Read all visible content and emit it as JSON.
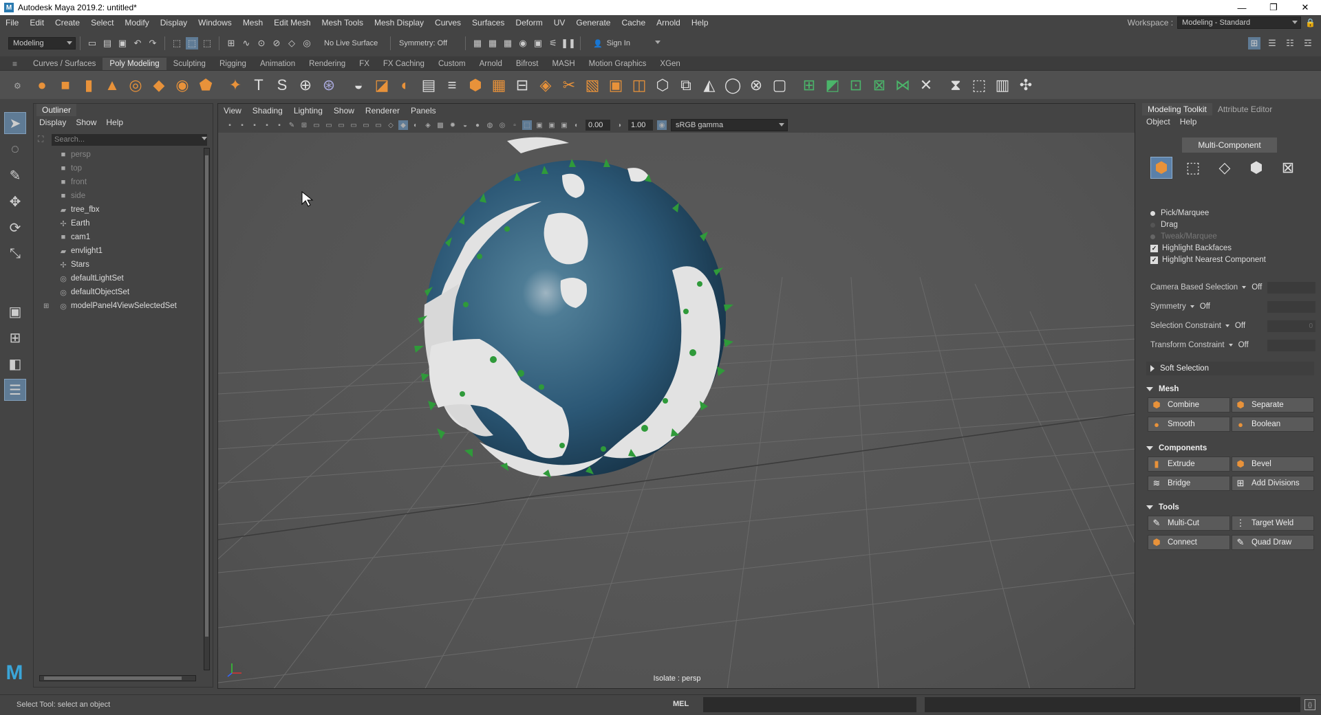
{
  "title": "Autodesk Maya 2019.2: untitled*",
  "window_controls": {
    "minimize": "—",
    "restore": "❐",
    "close": "✕"
  },
  "menu": [
    "File",
    "Edit",
    "Create",
    "Select",
    "Modify",
    "Display",
    "Windows",
    "Mesh",
    "Edit Mesh",
    "Mesh Tools",
    "Mesh Display",
    "Curves",
    "Surfaces",
    "Deform",
    "UV",
    "Generate",
    "Cache",
    "Arnold",
    "Help"
  ],
  "workspace": {
    "label": "Workspace :",
    "value": "Modeling - Standard"
  },
  "statusline": {
    "mode": "Modeling",
    "live_surface": "No Live Surface",
    "symmetry": "Symmetry: Off",
    "sign_in": "Sign In"
  },
  "shelf_tabs": [
    "Curves / Surfaces",
    "Poly Modeling",
    "Sculpting",
    "Rigging",
    "Animation",
    "Rendering",
    "FX",
    "FX Caching",
    "Custom",
    "Arnold",
    "Bifrost",
    "MASH",
    "Motion Graphics",
    "XGen"
  ],
  "shelf_active": "Poly Modeling",
  "shelf_icons": [
    "sphere",
    "cube",
    "cylinder",
    "cone",
    "torus",
    "plane",
    "disc",
    "platonic",
    "superShape",
    "type",
    "svg",
    "pivot",
    "uv",
    "combine",
    "separate",
    "bool",
    "extrude",
    "bridge",
    "bevel",
    "edge",
    "insert",
    "target",
    "multicut",
    "offset",
    "fill",
    "append",
    "smooth",
    "mirror",
    "reduce",
    "circularize",
    "pin",
    "uv-editor",
    "uv-planar",
    "uv-auto",
    "uv-cyl",
    "uv-sph",
    "uv-snap",
    "uv-cut",
    "uv-sew",
    "uv-unfold",
    "uv-layout",
    "uv-distort"
  ],
  "outliner": {
    "tab": "Outliner",
    "menu": [
      "Display",
      "Show",
      "Help"
    ],
    "search_placeholder": "Search...",
    "items": [
      {
        "label": "persp",
        "icon": "camera-icon",
        "dim": true
      },
      {
        "label": "top",
        "icon": "camera-icon",
        "dim": true
      },
      {
        "label": "front",
        "icon": "camera-icon",
        "dim": true
      },
      {
        "label": "side",
        "icon": "camera-icon",
        "dim": true
      },
      {
        "label": "tree_fbx",
        "icon": "mesh-icon",
        "dim": false
      },
      {
        "label": "Earth",
        "icon": "transform-icon",
        "dim": false
      },
      {
        "label": "cam1",
        "icon": "camera-icon",
        "dim": false
      },
      {
        "label": "envlight1",
        "icon": "mesh-icon",
        "dim": false
      },
      {
        "label": "Stars",
        "icon": "transform-icon",
        "dim": false
      },
      {
        "label": "defaultLightSet",
        "icon": "set-icon",
        "dim": false
      },
      {
        "label": "defaultObjectSet",
        "icon": "set-icon",
        "dim": false
      },
      {
        "label": "modelPanel4ViewSelectedSet",
        "icon": "set-icon",
        "dim": false,
        "expand": "⊞"
      }
    ]
  },
  "viewport": {
    "menu": [
      "View",
      "Shading",
      "Lighting",
      "Show",
      "Renderer",
      "Panels"
    ],
    "exposure": "0.00",
    "gamma": "1.00",
    "color_space": "sRGB gamma",
    "isolate_label": "Isolate : persp"
  },
  "modeling_toolkit": {
    "tabs": [
      "Modeling Toolkit",
      "Attribute Editor"
    ],
    "menu": [
      "Object",
      "Help"
    ],
    "multi_component": "Multi-Component",
    "selection_modes": [
      {
        "label": "Pick/Marquee",
        "dim": false
      },
      {
        "label": "Drag",
        "dim": false
      },
      {
        "label": "Tweak/Marquee",
        "dim": true
      }
    ],
    "checkboxes": [
      {
        "label": "Highlight Backfaces",
        "checked": true
      },
      {
        "label": "Highlight Nearest Component",
        "checked": true
      }
    ],
    "options": [
      {
        "label": "Camera Based Selection",
        "value": "Off"
      },
      {
        "label": "Symmetry",
        "value": "Off"
      },
      {
        "label": "Selection Constraint",
        "value": "Off",
        "extra": "0"
      },
      {
        "label": "Transform Constraint",
        "value": "Off"
      }
    ],
    "soft_selection": "Soft Selection",
    "sections": {
      "mesh": "Mesh",
      "components": "Components",
      "tools": "Tools"
    },
    "mesh_buttons": [
      "Combine",
      "Separate",
      "Smooth",
      "Boolean"
    ],
    "component_buttons": [
      "Extrude",
      "Bevel",
      "Bridge",
      "Add Divisions"
    ],
    "tool_buttons": [
      "Multi-Cut",
      "Target Weld",
      "Connect",
      "Quad Draw"
    ]
  },
  "commandline": {
    "help": "Select Tool: select an object",
    "mel": "MEL"
  },
  "colors": {
    "ocean": "#2b5775",
    "snow": "#e2e2e2",
    "trees": "#2f9a3a",
    "accent": "#5b80a8",
    "maya_logo": "#3aa5d8"
  }
}
